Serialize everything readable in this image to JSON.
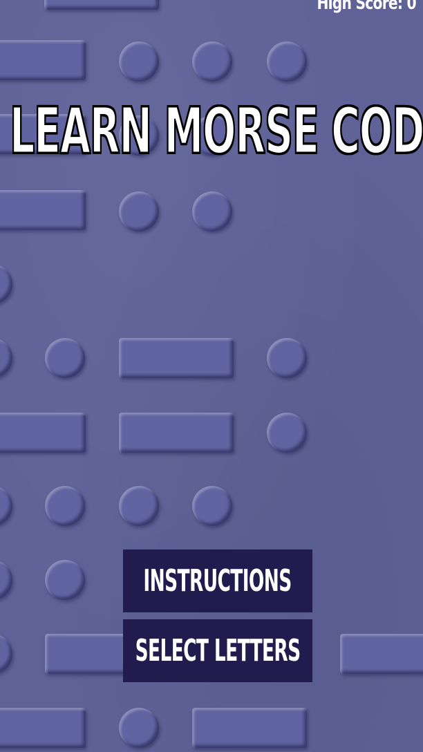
{
  "game": {
    "high_score_text": "High Score: 0",
    "title": "LEARN MORSE CODE"
  },
  "menu": {
    "instructions_label": "INSTRUCTIONS",
    "select_letters_label": "SELECT LETTERS"
  },
  "colors": {
    "background": "#5e6297",
    "button": "#221b4d",
    "title_fill": "#ffffff",
    "title_outline": "#000000"
  }
}
